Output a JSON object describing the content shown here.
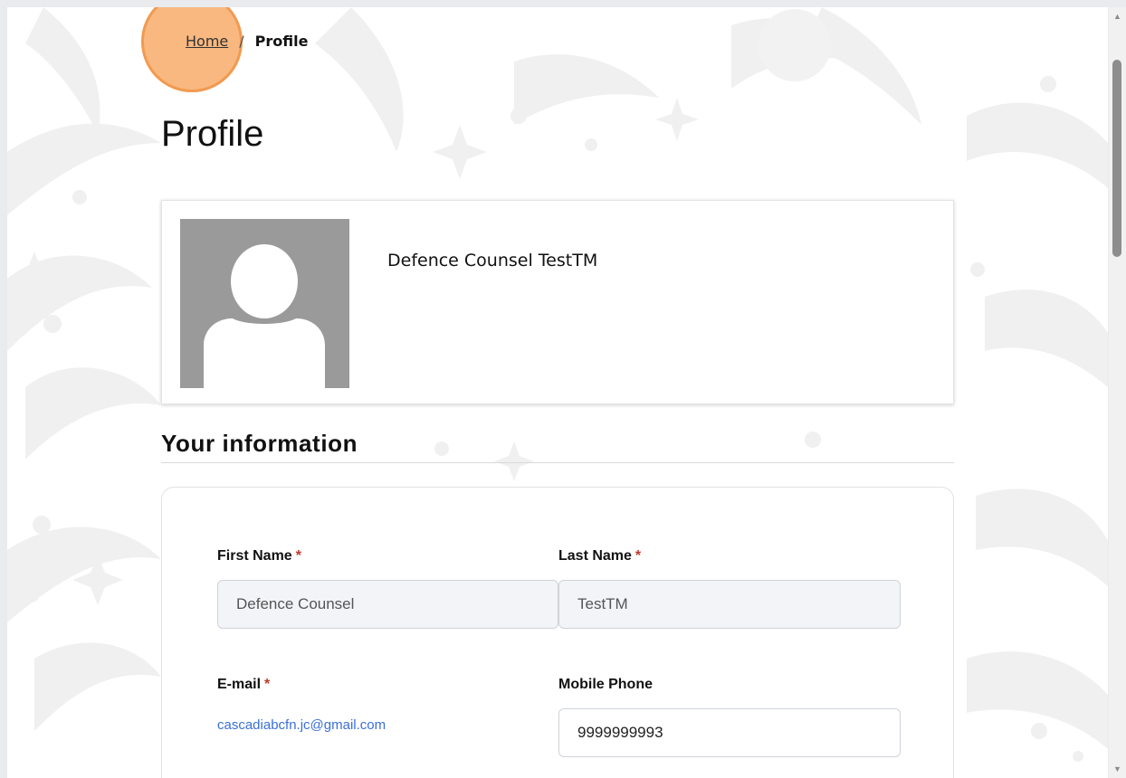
{
  "breadcrumb": {
    "home_label": "Home",
    "current_label": "Profile"
  },
  "page": {
    "title": "Profile"
  },
  "profile_card": {
    "display_name": "Defence Counsel TestTM",
    "avatar_icon": "user-silhouette-icon"
  },
  "section": {
    "title": "Your information"
  },
  "form": {
    "first_name": {
      "label": "First Name",
      "required_mark": "*",
      "value": "Defence Counsel"
    },
    "last_name": {
      "label": "Last Name",
      "required_mark": "*",
      "value": "TestTM"
    },
    "email": {
      "label": "E-mail",
      "required_mark": "*",
      "value": "cascadiabcfn.jc@gmail.com"
    },
    "mobile_phone": {
      "label": "Mobile Phone",
      "value": "9999999993"
    }
  },
  "colors": {
    "accent_link": "#3a6fd8",
    "required": "#c0392b",
    "click_highlight": "#f29a4f"
  }
}
